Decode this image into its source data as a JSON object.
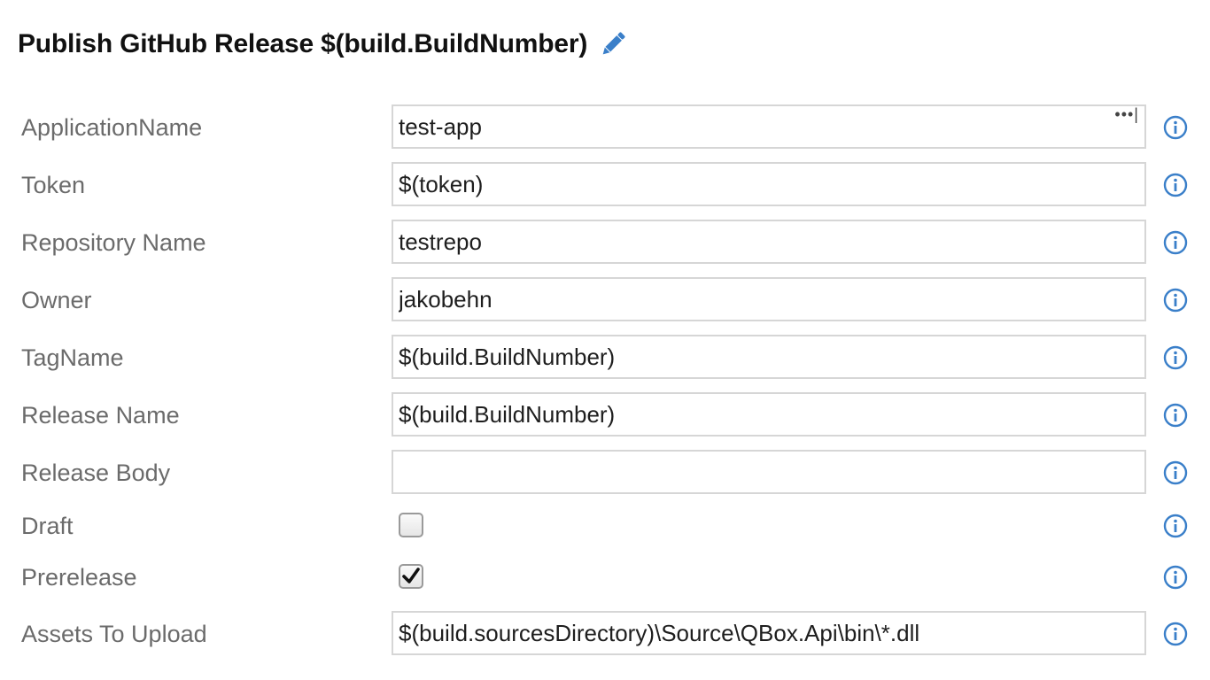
{
  "header": {
    "title": "Publish GitHub Release $(build.BuildNumber)",
    "edit_icon": "pencil-icon"
  },
  "accent_color": "#3a7fc9",
  "fields": [
    {
      "label": "ApplicationName",
      "value": "test-app",
      "type": "text",
      "extra_button": "•••|"
    },
    {
      "label": "Token",
      "value": "$(token)",
      "type": "text"
    },
    {
      "label": "Repository Name",
      "value": "testrepo",
      "type": "text"
    },
    {
      "label": "Owner",
      "value": "jakobehn",
      "type": "text"
    },
    {
      "label": "TagName",
      "value": "$(build.BuildNumber)",
      "type": "text"
    },
    {
      "label": "Release Name",
      "value": "$(build.BuildNumber)",
      "type": "text"
    },
    {
      "label": "Release Body",
      "value": "",
      "type": "text"
    },
    {
      "label": "Draft",
      "checked": false,
      "type": "checkbox"
    },
    {
      "label": "Prerelease",
      "checked": true,
      "type": "checkbox"
    },
    {
      "label": "Assets To Upload",
      "value": "$(build.sourcesDirectory)\\Source\\QBox.Api\\bin\\*.dll",
      "type": "text"
    }
  ],
  "info_icon": "info-icon"
}
